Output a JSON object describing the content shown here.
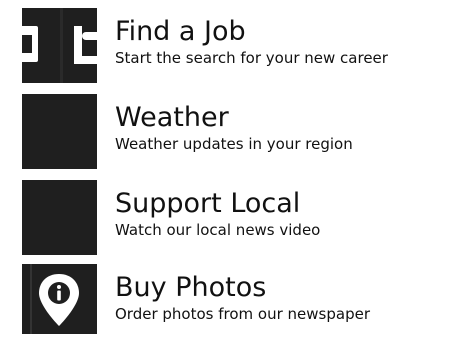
{
  "items": [
    {
      "title": "Find a Job",
      "subtitle": "Start the search for your new career",
      "icon": "briefcase-icon"
    },
    {
      "title": "Weather",
      "subtitle": "Weather updates in your region",
      "icon": ""
    },
    {
      "title": "Support Local",
      "subtitle": "Watch our local news video",
      "icon": ""
    },
    {
      "title": "Buy Photos",
      "subtitle": "Order photos from our newspaper",
      "icon": "location-pin-icon"
    }
  ],
  "colors": {
    "thumbnail_bg": "#1f1f1f",
    "text": "#111111",
    "background": "#ffffff"
  }
}
